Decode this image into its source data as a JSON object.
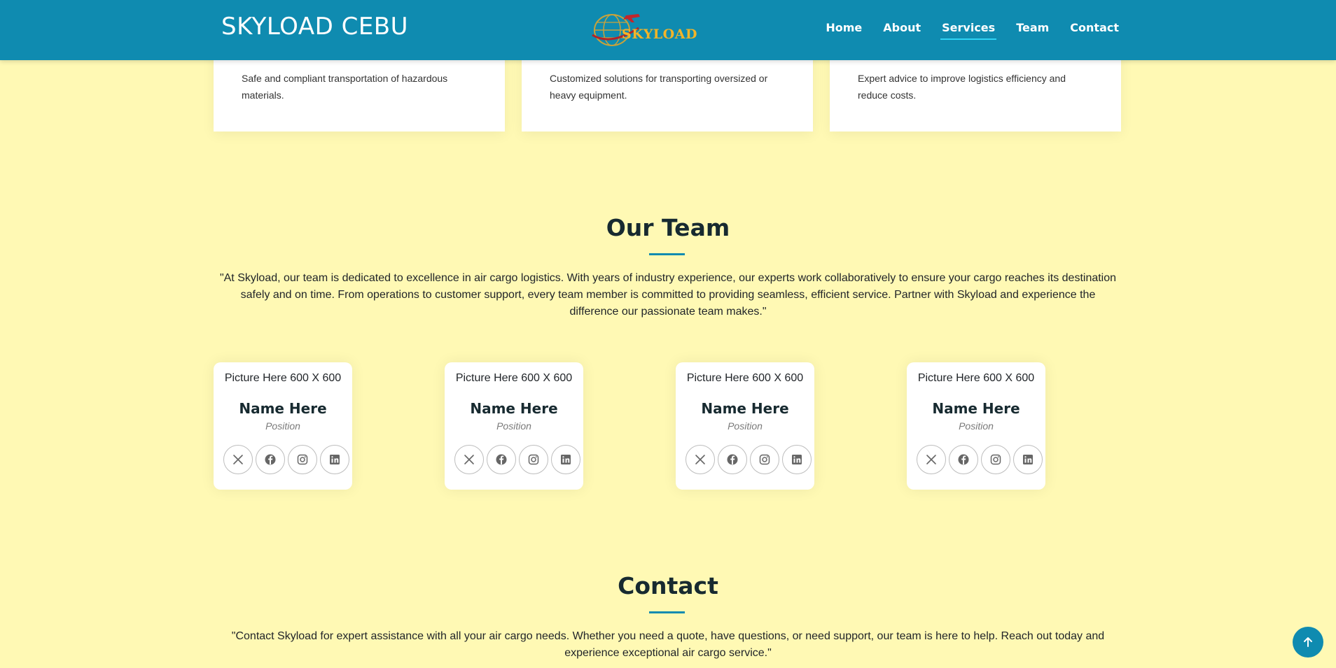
{
  "header": {
    "brand": "SKYLOAD CEBU",
    "logo_text": "SKYLOAD",
    "nav": [
      {
        "label": "Home"
      },
      {
        "label": "About"
      },
      {
        "label": "Services",
        "active": true
      },
      {
        "label": "Team"
      },
      {
        "label": "Contact"
      }
    ]
  },
  "services": [
    {
      "text": "Safe and compliant transportation of hazardous materials."
    },
    {
      "text": "Customized solutions for transporting oversized or heavy equipment."
    },
    {
      "text": "Expert advice to improve logistics efficiency and reduce costs."
    }
  ],
  "team": {
    "title": "Our Team",
    "description": "\"At Skyload, our team is dedicated to excellence in air cargo logistics. With years of industry experience, our experts work collaboratively to ensure your cargo reaches its destination safely and on time. From operations to customer support, every team member is committed to providing seamless, efficient service. Partner with Skyload and experience the difference our passionate team makes.\"",
    "members": [
      {
        "picture": "Picture Here 600 X 600",
        "name": "Name Here",
        "position": "Position"
      },
      {
        "picture": "Picture Here 600 X 600",
        "name": "Name Here",
        "position": "Position"
      },
      {
        "picture": "Picture Here 600 X 600",
        "name": "Name Here",
        "position": "Position"
      },
      {
        "picture": "Picture Here 600 X 600",
        "name": "Name Here",
        "position": "Position"
      }
    ],
    "social_icons": [
      "x-icon",
      "facebook-icon",
      "instagram-icon",
      "linkedin-icon"
    ]
  },
  "contact": {
    "title": "Contact",
    "description": "\"Contact Skyload for expert assistance with all your air cargo needs. Whether you need a quote, have questions, or need support, our team is here to help. Reach out today and experience exceptional air cargo service.\""
  },
  "back_to_top": {
    "icon": "arrow-up-icon"
  },
  "colors": {
    "header": "#0f8bb0",
    "background": "#fff9b4",
    "accent_underline": "#2fd3f5",
    "logo_gold": "#f3b428",
    "heading": "#172a30"
  }
}
